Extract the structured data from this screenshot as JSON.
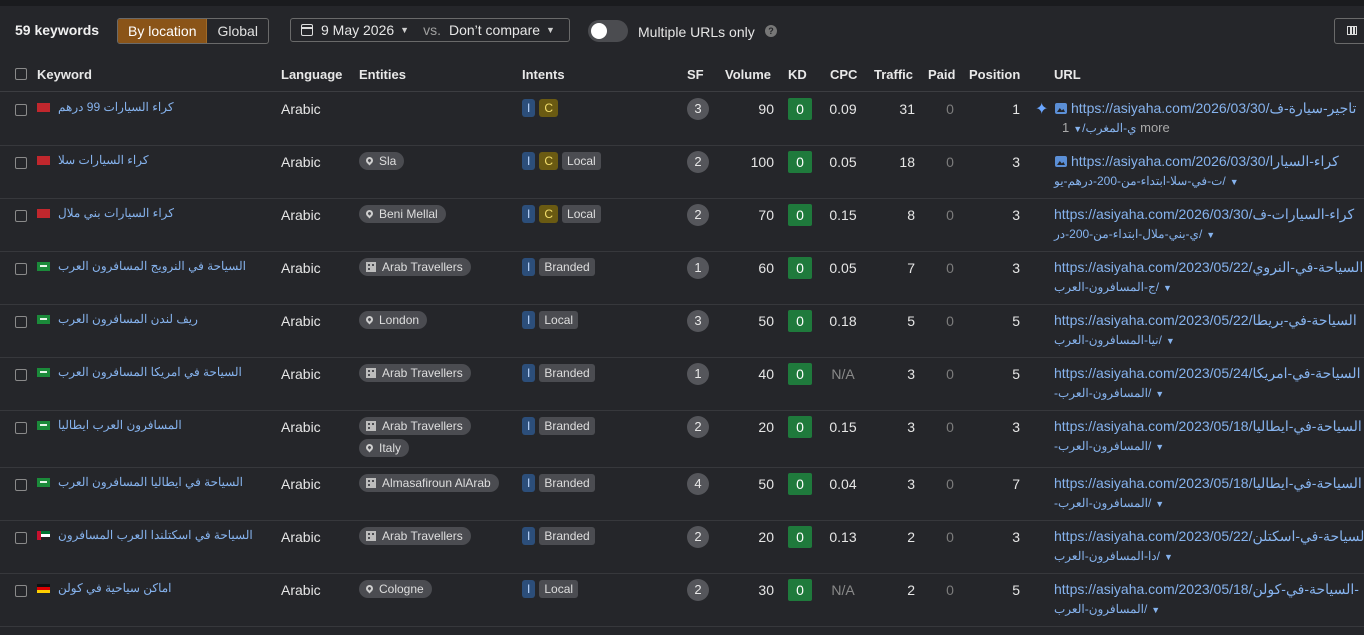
{
  "toolbar": {
    "keywords_count": "59 keywords",
    "by_location": "By location",
    "global": "Global",
    "date": "9 May 2026",
    "vs": "vs.",
    "compare": "Don’t compare",
    "multiple_urls": "Multiple URLs only"
  },
  "headers": {
    "keyword": "Keyword",
    "language": "Language",
    "entities": "Entities",
    "intents": "Intents",
    "sf": "SF",
    "volume": "Volume",
    "kd": "KD",
    "cpc": "CPC",
    "traffic": "Traffic",
    "paid": "Paid",
    "position": "Position",
    "url": "URL"
  },
  "rows": [
    {
      "keyword": "كراء السيارات 99 درهم",
      "flag": "ma",
      "language": "Arabic",
      "entities": [],
      "intents": [
        "I",
        "C"
      ],
      "sf": "3",
      "volume": "90",
      "kd": "0",
      "cpc": "0.09",
      "traffic": "31",
      "paid": "0",
      "position": "1",
      "url_line1": "https://asiyaha.com/2026/03/30/تاجير-سيارة-ف",
      "url_line2": "ي-المغرب/",
      "more": "1 more"
    },
    {
      "keyword": "كراء السيارات سلا",
      "flag": "ma",
      "language": "Arabic",
      "entities": [
        {
          "icon": "pin",
          "label": "Sla"
        }
      ],
      "intents": [
        "I",
        "C",
        "Local"
      ],
      "sf": "2",
      "volume": "100",
      "kd": "0",
      "cpc": "0.05",
      "traffic": "18",
      "paid": "0",
      "position": "3",
      "url_line1": "https://asiyaha.com/2026/03/30/كراء-السيارا",
      "url_line2": "ت-في-سلا-ابتداء-من-200-درهم-يو/"
    },
    {
      "keyword": "كراء السيارات بني ملال",
      "flag": "ma",
      "language": "Arabic",
      "entities": [
        {
          "icon": "pin",
          "label": "Beni Mellal"
        }
      ],
      "intents": [
        "I",
        "C",
        "Local"
      ],
      "sf": "2",
      "volume": "70",
      "kd": "0",
      "cpc": "0.15",
      "traffic": "8",
      "paid": "0",
      "position": "3",
      "url_line1": "https://asiyaha.com/2026/03/30/كراء-السيارات-ف",
      "url_line2": "ي-بني-ملال-ابتداء-من-200-در/"
    },
    {
      "keyword": "السياحة في النرويج المسافرون العرب",
      "flag": "sa",
      "language": "Arabic",
      "entities": [
        {
          "icon": "building",
          "label": "Arab Travellers"
        }
      ],
      "intents": [
        "I",
        "Branded"
      ],
      "sf": "1",
      "volume": "60",
      "kd": "0",
      "cpc": "0.05",
      "traffic": "7",
      "paid": "0",
      "position": "3",
      "url_line1": "https://asiyaha.com/2023/05/22/السياحة-في-النروي",
      "url_line2": "ج-المسافرون-العرب/"
    },
    {
      "keyword": "ريف لندن المسافرون العرب",
      "flag": "sa",
      "language": "Arabic",
      "entities": [
        {
          "icon": "pin",
          "label": "London"
        }
      ],
      "intents": [
        "I",
        "Local"
      ],
      "sf": "3",
      "volume": "50",
      "kd": "0",
      "cpc": "0.18",
      "traffic": "5",
      "paid": "0",
      "position": "5",
      "url_line1": "https://asiyaha.com/2023/05/22/السياحة-في-بريطا",
      "url_line2": "نيا-المسافرون-العرب/"
    },
    {
      "keyword": "السياحة في امريكا المسافرون العرب",
      "flag": "sa",
      "language": "Arabic",
      "entities": [
        {
          "icon": "building",
          "label": "Arab Travellers"
        }
      ],
      "intents": [
        "I",
        "Branded"
      ],
      "sf": "1",
      "volume": "40",
      "kd": "0",
      "cpc": "N/A",
      "traffic": "3",
      "paid": "0",
      "position": "5",
      "url_line1": "https://asiyaha.com/2023/05/24/السياحة-في-امريكا",
      "url_line2": "-المسافرون-العرب/"
    },
    {
      "keyword": "المسافرون العرب ايطاليا",
      "flag": "sa",
      "language": "Arabic",
      "entities": [
        {
          "icon": "building",
          "label": "Arab Travellers"
        },
        {
          "icon": "pin",
          "label": "Italy"
        }
      ],
      "intents": [
        "I",
        "Branded"
      ],
      "sf": "2",
      "volume": "20",
      "kd": "0",
      "cpc": "0.15",
      "traffic": "3",
      "paid": "0",
      "position": "3",
      "url_line1": "https://asiyaha.com/2023/05/18/السياحة-في-ايطاليا",
      "url_line2": "-المسافرون-العرب/"
    },
    {
      "keyword": "السياحة في ايطاليا المسافرون العرب",
      "flag": "sa",
      "language": "Arabic",
      "entities": [
        {
          "icon": "building",
          "label": "Almasafiroun AlArab"
        }
      ],
      "intents": [
        "I",
        "Branded"
      ],
      "sf": "4",
      "volume": "50",
      "kd": "0",
      "cpc": "0.04",
      "traffic": "3",
      "paid": "0",
      "position": "7",
      "url_line1": "https://asiyaha.com/2023/05/18/السياحة-في-ايطاليا",
      "url_line2": "-المسافرون-العرب/"
    },
    {
      "keyword": "السياحة في اسكتلندا العرب المسافرون",
      "flag": "ae",
      "language": "Arabic",
      "entities": [
        {
          "icon": "building",
          "label": "Arab Travellers"
        }
      ],
      "intents": [
        "I",
        "Branded"
      ],
      "sf": "2",
      "volume": "20",
      "kd": "0",
      "cpc": "0.13",
      "traffic": "2",
      "paid": "0",
      "position": "3",
      "url_line1": "https://asiyaha.com/2023/05/22/السياحة-في-اسكتلن",
      "url_line2": "دا-المسافرون-العرب/"
    },
    {
      "keyword": "اماكن سياحية في كولن",
      "flag": "de",
      "language": "Arabic",
      "entities": [
        {
          "icon": "pin",
          "label": "Cologne"
        }
      ],
      "intents": [
        "I",
        "Local"
      ],
      "sf": "2",
      "volume": "30",
      "kd": "0",
      "cpc": "N/A",
      "traffic": "2",
      "paid": "0",
      "position": "5",
      "url_line1": "https://asiyaha.com/2023/05/18/السياحة-في-كولن-",
      "url_line2": "المسافرون-العرب/"
    }
  ]
}
